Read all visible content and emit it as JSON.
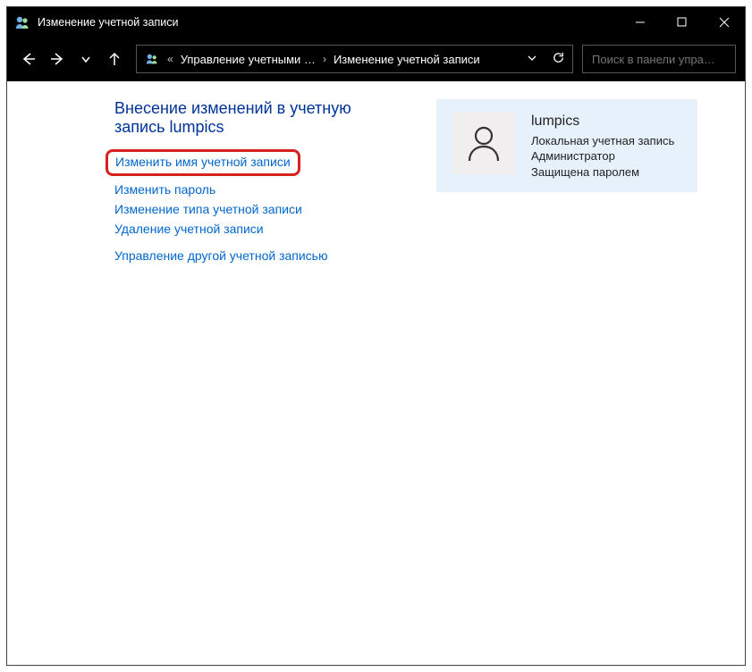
{
  "window": {
    "title": "Изменение учетной записи"
  },
  "nav": {
    "breadcrumb_prefix": "«",
    "crumb1": "Управление учетными …",
    "crumb2": "Изменение учетной записи",
    "search_placeholder": "Поиск в панели упра…"
  },
  "content": {
    "heading": "Внесение изменений в учетную запись lumpics",
    "links": {
      "rename": "Изменить имя учетной записи",
      "password": "Изменить пароль",
      "type": "Изменение типа учетной записи",
      "delete": "Удаление учетной записи",
      "other": "Управление другой учетной записью"
    },
    "account": {
      "name": "lumpics",
      "type": "Локальная учетная запись",
      "role": "Администратор",
      "protected": "Защищена паролем"
    }
  }
}
